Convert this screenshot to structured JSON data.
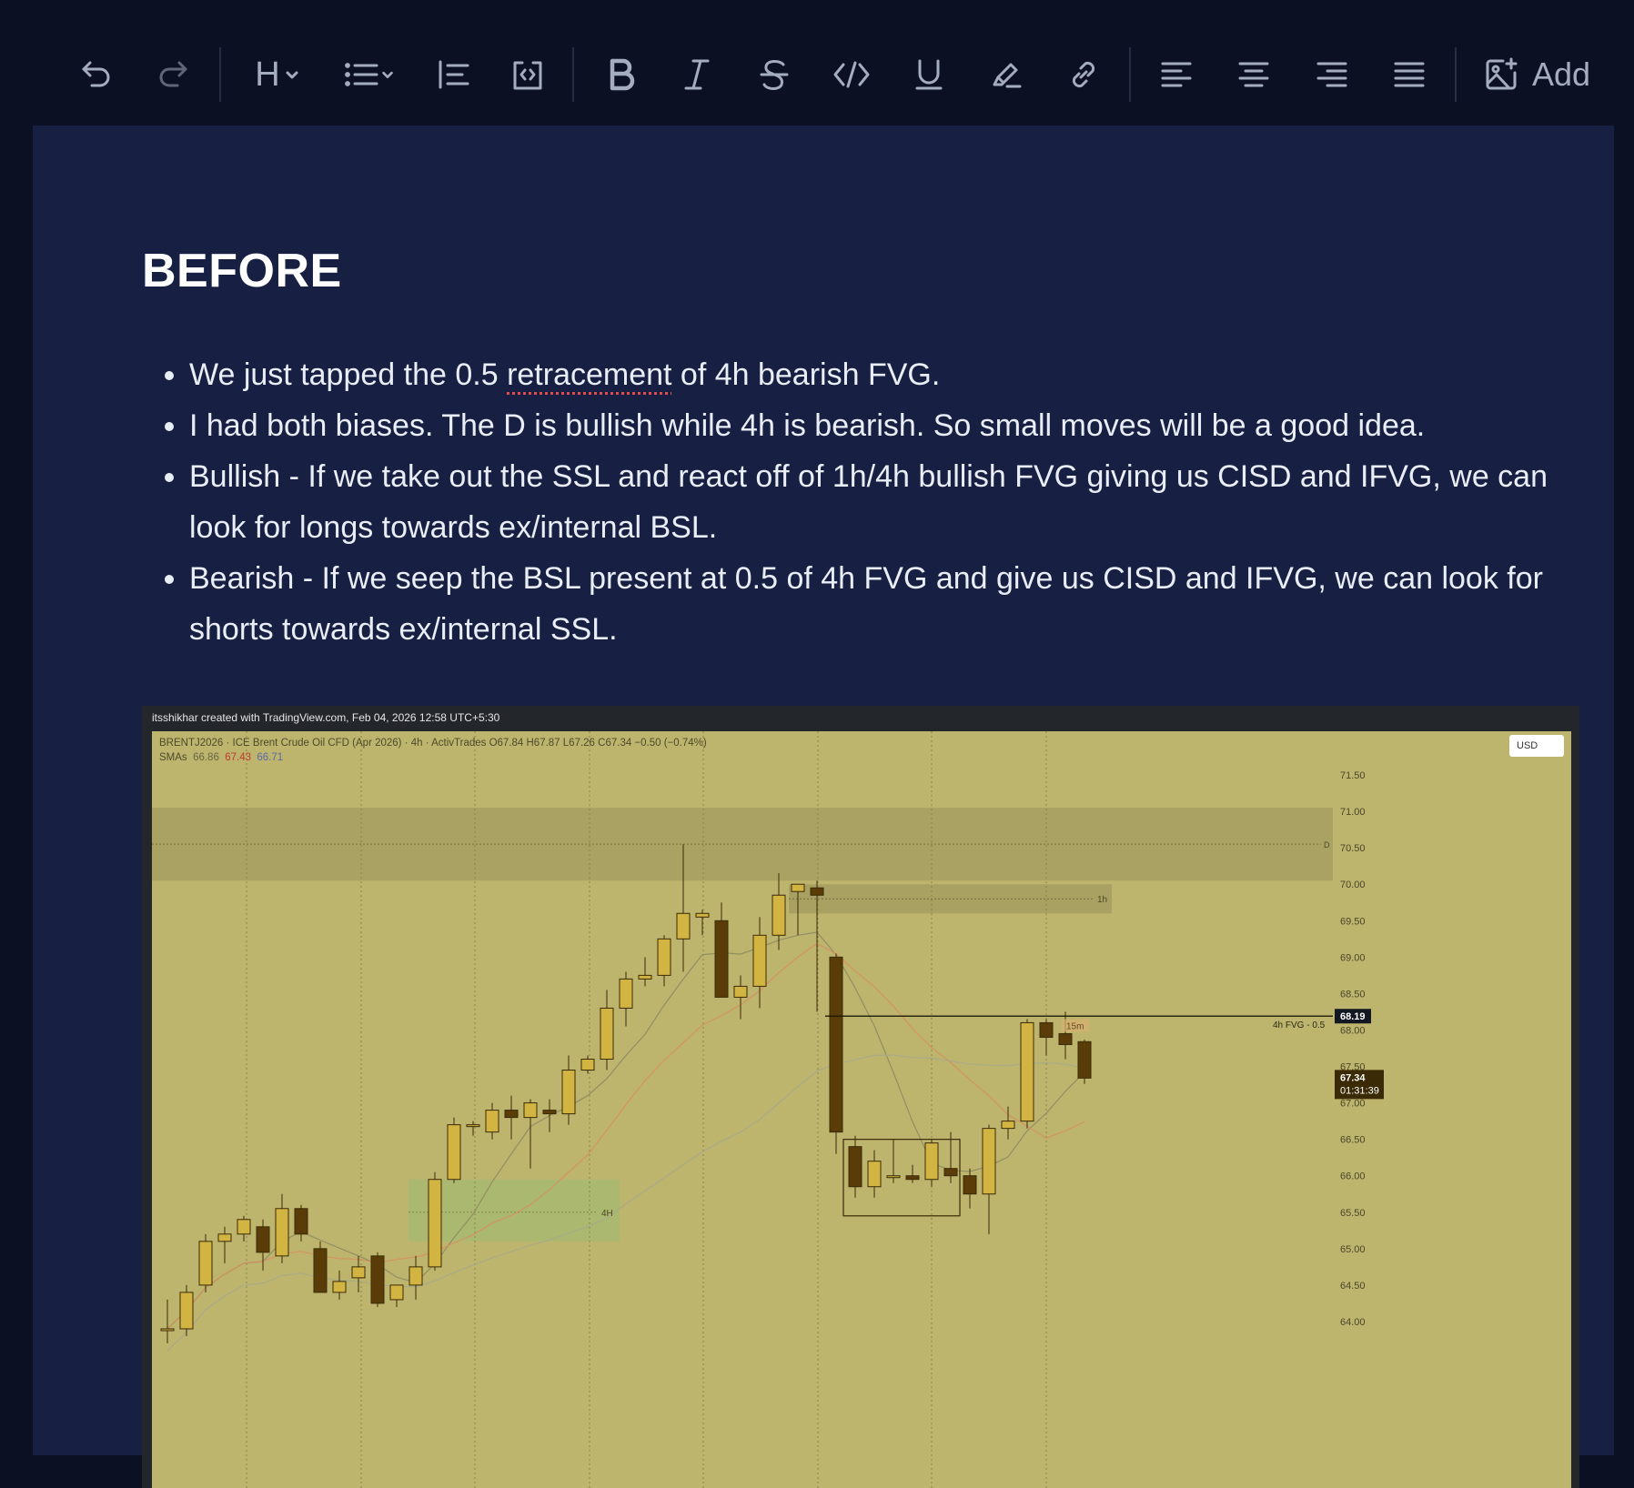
{
  "toolbar": {
    "items": [
      "undo-icon",
      "redo-icon",
      "heading-icon",
      "list-icon",
      "blockquote-icon",
      "code-block-icon",
      "bold-icon",
      "italic-icon",
      "strikethrough-icon",
      "code-icon",
      "underline-icon",
      "highlight-icon",
      "link-icon",
      "align-left-icon",
      "align-center-icon",
      "align-right-icon",
      "align-justify-icon",
      "add-image-icon"
    ],
    "heading_label": "H",
    "add_label": "Add"
  },
  "document": {
    "heading": "BEFORE",
    "bullets": [
      {
        "before": "We just tapped the 0.5 ",
        "misspelled": "retracement",
        "after": " of 4h bearish FVG."
      },
      {
        "text": "I had both biases. The D is bullish while 4h is bearish. So small moves will be a good idea."
      },
      {
        "text": "Bullish - If we take out the SSL and react off of 1h/4h bullish FVG giving us CISD and IFVG, we can look for longs towards ex/internal BSL."
      },
      {
        "text": "Bearish - If we seep the BSL present at 0.5 of 4h FVG and give us CISD and IFVG, we can look for shorts towards ex/internal SSL."
      }
    ]
  },
  "chart_image": {
    "credit": "itsshikhar created with TradingView.com, Feb 04, 2026 12:58 UTC+5:30",
    "info_line": "BRENTJ2026 · ICE Brent Crude Oil CFD (Apr 2026) · 4h · ActivTrades  O67.84  H67.87  L67.26  C67.34  −0.50 (−0.74%)",
    "sma_label": "SMAs",
    "sma_values": [
      "66.86",
      "67.43",
      "66.71"
    ],
    "currency_button": "USD",
    "annotations": {
      "d_level": "D",
      "h1_zone": "1h",
      "h4_zone": "4H",
      "fvg_line": "4h FVG - 0.5",
      "m15": "15m"
    },
    "price_tag_line": "68.19",
    "price_tag_last": "67.34",
    "countdown": "01:31:39",
    "colors": {
      "background": "#bdb46e",
      "bull": "#d2b442",
      "bear": "#5a3c08",
      "grid": "#9c9457"
    }
  },
  "chart_data": {
    "type": "candlestick",
    "title": "",
    "y_ticks": [
      "71.50",
      "71.00",
      "70.50",
      "70.00",
      "69.50",
      "69.00",
      "68.50",
      "68.00",
      "67.50",
      "67.00",
      "66.50",
      "66.00",
      "65.50",
      "65.00",
      "64.50",
      "64.00"
    ],
    "ylim": [
      63.8,
      71.6
    ],
    "grid": true,
    "candles": [
      {
        "o": 63.9,
        "h": 64.3,
        "l": 63.7,
        "c": 63.9
      },
      {
        "o": 63.9,
        "h": 64.5,
        "l": 63.8,
        "c": 64.4
      },
      {
        "o": 64.5,
        "h": 65.2,
        "l": 64.4,
        "c": 65.1
      },
      {
        "o": 65.1,
        "h": 65.3,
        "l": 64.8,
        "c": 65.2
      },
      {
        "o": 65.2,
        "h": 65.45,
        "l": 65.1,
        "c": 65.4
      },
      {
        "o": 65.3,
        "h": 65.4,
        "l": 64.7,
        "c": 64.95
      },
      {
        "o": 64.9,
        "h": 65.75,
        "l": 64.8,
        "c": 65.55
      },
      {
        "o": 65.55,
        "h": 65.6,
        "l": 65.1,
        "c": 65.2
      },
      {
        "o": 65.0,
        "h": 65.1,
        "l": 64.4,
        "c": 64.4
      },
      {
        "o": 64.4,
        "h": 64.7,
        "l": 64.3,
        "c": 64.55
      },
      {
        "o": 64.6,
        "h": 64.9,
        "l": 64.4,
        "c": 64.75
      },
      {
        "o": 64.9,
        "h": 64.95,
        "l": 64.2,
        "c": 64.25
      },
      {
        "o": 64.3,
        "h": 64.5,
        "l": 64.2,
        "c": 64.5
      },
      {
        "o": 64.5,
        "h": 64.9,
        "l": 64.3,
        "c": 64.75
      },
      {
        "o": 64.75,
        "h": 66.05,
        "l": 64.7,
        "c": 65.95
      },
      {
        "o": 65.95,
        "h": 66.8,
        "l": 65.9,
        "c": 66.7
      },
      {
        "o": 66.7,
        "h": 66.75,
        "l": 66.55,
        "c": 66.7
      },
      {
        "o": 66.6,
        "h": 67.0,
        "l": 66.5,
        "c": 66.9
      },
      {
        "o": 66.9,
        "h": 67.1,
        "l": 66.5,
        "c": 66.8
      },
      {
        "o": 66.8,
        "h": 67.05,
        "l": 66.1,
        "c": 67.0
      },
      {
        "o": 66.9,
        "h": 67.05,
        "l": 66.6,
        "c": 66.85
      },
      {
        "o": 66.85,
        "h": 67.65,
        "l": 66.7,
        "c": 67.45
      },
      {
        "o": 67.45,
        "h": 67.65,
        "l": 67.4,
        "c": 67.6
      },
      {
        "o": 67.6,
        "h": 68.55,
        "l": 67.45,
        "c": 68.3
      },
      {
        "o": 68.3,
        "h": 68.8,
        "l": 68.05,
        "c": 68.7
      },
      {
        "o": 68.7,
        "h": 69.0,
        "l": 68.6,
        "c": 68.75
      },
      {
        "o": 68.75,
        "h": 69.3,
        "l": 68.6,
        "c": 69.25
      },
      {
        "o": 69.25,
        "h": 70.55,
        "l": 68.8,
        "c": 69.6
      },
      {
        "o": 69.55,
        "h": 69.65,
        "l": 69.3,
        "c": 69.6
      },
      {
        "o": 69.5,
        "h": 69.75,
        "l": 68.45,
        "c": 68.45
      },
      {
        "o": 68.45,
        "h": 68.75,
        "l": 68.15,
        "c": 68.6
      },
      {
        "o": 68.6,
        "h": 69.55,
        "l": 68.3,
        "c": 69.3
      },
      {
        "o": 69.3,
        "h": 70.15,
        "l": 69.1,
        "c": 69.85
      },
      {
        "o": 69.9,
        "h": 70.0,
        "l": 69.3,
        "c": 70.0
      },
      {
        "o": 69.95,
        "h": 70.05,
        "l": 68.25,
        "c": 69.85
      },
      {
        "o": 69.0,
        "h": 69.05,
        "l": 66.3,
        "c": 66.6
      },
      {
        "o": 66.4,
        "h": 66.55,
        "l": 65.7,
        "c": 65.85
      },
      {
        "o": 65.85,
        "h": 66.35,
        "l": 65.7,
        "c": 66.2
      },
      {
        "o": 66.0,
        "h": 66.5,
        "l": 65.9,
        "c": 66.0
      },
      {
        "o": 66.0,
        "h": 66.15,
        "l": 65.9,
        "c": 65.95
      },
      {
        "o": 65.95,
        "h": 66.5,
        "l": 65.85,
        "c": 66.45
      },
      {
        "o": 66.1,
        "h": 66.6,
        "l": 65.9,
        "c": 66.0
      },
      {
        "o": 66.0,
        "h": 66.1,
        "l": 65.55,
        "c": 65.75
      },
      {
        "o": 65.75,
        "h": 66.7,
        "l": 65.2,
        "c": 66.65
      },
      {
        "o": 66.65,
        "h": 66.95,
        "l": 66.5,
        "c": 66.75
      },
      {
        "o": 66.75,
        "h": 68.15,
        "l": 66.65,
        "c": 68.1
      },
      {
        "o": 68.1,
        "h": 68.15,
        "l": 67.65,
        "c": 67.9
      },
      {
        "o": 67.95,
        "h": 68.25,
        "l": 67.6,
        "c": 67.8
      },
      {
        "o": 67.84,
        "h": 67.87,
        "l": 67.26,
        "c": 67.34
      }
    ]
  }
}
